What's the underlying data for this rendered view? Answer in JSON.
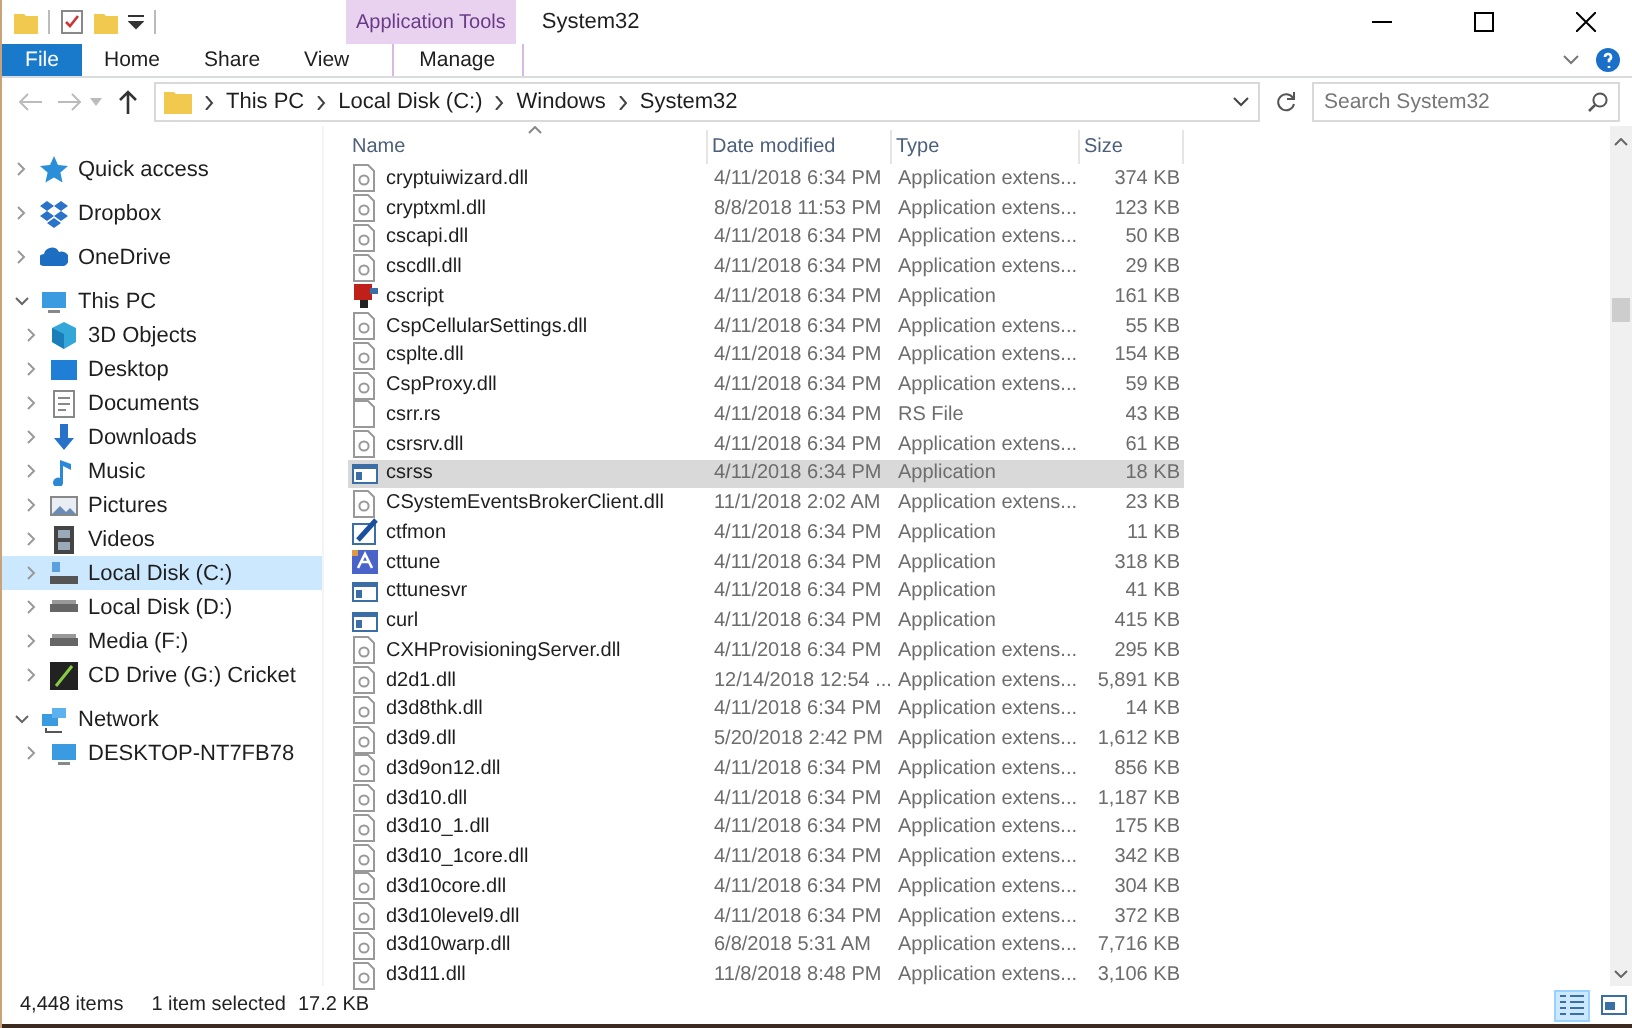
{
  "window": {
    "contextual_tab": "Application Tools",
    "title": "System32"
  },
  "ribbon_tabs": [
    {
      "label": "File",
      "kind": "file"
    },
    {
      "label": "Home",
      "kind": "normal"
    },
    {
      "label": "Share",
      "kind": "normal"
    },
    {
      "label": "View",
      "kind": "normal"
    },
    {
      "label": "Manage",
      "kind": "contextual"
    }
  ],
  "address_bar": {
    "path": [
      "This PC",
      "Local Disk (C:)",
      "Windows",
      "System32"
    ]
  },
  "search": {
    "placeholder": "Search System32"
  },
  "sidebar": {
    "items": [
      {
        "label": "Quick access",
        "kind": "star",
        "expanded": false,
        "selected": false
      },
      {
        "label": "Dropbox",
        "kind": "dropbox",
        "expanded": false,
        "selected": false
      },
      {
        "label": "OneDrive",
        "kind": "cloud",
        "expanded": false,
        "selected": false
      },
      {
        "label": "This PC",
        "kind": "pc",
        "expanded": true,
        "selected": false,
        "children": [
          {
            "label": "3D Objects",
            "kind": "cube",
            "expanded": false,
            "selected": false
          },
          {
            "label": "Desktop",
            "kind": "desktop",
            "expanded": false,
            "selected": false
          },
          {
            "label": "Documents",
            "kind": "document",
            "expanded": false,
            "selected": false
          },
          {
            "label": "Downloads",
            "kind": "download",
            "expanded": false,
            "selected": false
          },
          {
            "label": "Music",
            "kind": "music",
            "expanded": false,
            "selected": false
          },
          {
            "label": "Pictures",
            "kind": "pictures",
            "expanded": false,
            "selected": false
          },
          {
            "label": "Videos",
            "kind": "film",
            "expanded": false,
            "selected": false
          },
          {
            "label": "Local Disk (C:)",
            "kind": "system-drive",
            "expanded": false,
            "selected": true
          },
          {
            "label": "Local Disk (D:)",
            "kind": "drive",
            "expanded": false,
            "selected": false
          },
          {
            "label": "Media (F:)",
            "kind": "drive",
            "expanded": false,
            "selected": false
          },
          {
            "label": "CD Drive (G:) Cricket",
            "kind": "cd",
            "expanded": false,
            "selected": false
          }
        ]
      },
      {
        "label": "Network",
        "kind": "network",
        "expanded": true,
        "selected": false,
        "children": [
          {
            "label": "DESKTOP-NT7FB78",
            "kind": "pc",
            "expanded": false,
            "selected": false
          }
        ]
      }
    ]
  },
  "table": {
    "columns": [
      {
        "label": "Name",
        "sorted": true
      },
      {
        "label": "Date modified",
        "sorted": false
      },
      {
        "label": "Type",
        "sorted": false
      },
      {
        "label": "Size",
        "sorted": false
      }
    ],
    "rows": [
      {
        "name": "cryptuiwizard.dll",
        "date": "4/11/2018 6:34 PM",
        "type": "Application extens...",
        "size": "374 KB",
        "kind": "dll",
        "selected": false
      },
      {
        "name": "cryptxml.dll",
        "date": "8/8/2018 11:53 PM",
        "type": "Application extens...",
        "size": "123 KB",
        "kind": "dll",
        "selected": false
      },
      {
        "name": "cscapi.dll",
        "date": "4/11/2018 6:34 PM",
        "type": "Application extens...",
        "size": "50 KB",
        "kind": "dll",
        "selected": false
      },
      {
        "name": "cscdll.dll",
        "date": "4/11/2018 6:34 PM",
        "type": "Application extens...",
        "size": "29 KB",
        "kind": "dll",
        "selected": false
      },
      {
        "name": "cscript",
        "date": "4/11/2018 6:34 PM",
        "type": "Application",
        "size": "161 KB",
        "kind": "script",
        "selected": false
      },
      {
        "name": "CspCellularSettings.dll",
        "date": "4/11/2018 6:34 PM",
        "type": "Application extens...",
        "size": "55 KB",
        "kind": "dll",
        "selected": false
      },
      {
        "name": "csplte.dll",
        "date": "4/11/2018 6:34 PM",
        "type": "Application extens...",
        "size": "154 KB",
        "kind": "dll",
        "selected": false
      },
      {
        "name": "CspProxy.dll",
        "date": "4/11/2018 6:34 PM",
        "type": "Application extens...",
        "size": "59 KB",
        "kind": "dll",
        "selected": false
      },
      {
        "name": "csrr.rs",
        "date": "4/11/2018 6:34 PM",
        "type": "RS File",
        "size": "43 KB",
        "kind": "file",
        "selected": false
      },
      {
        "name": "csrsrv.dll",
        "date": "4/11/2018 6:34 PM",
        "type": "Application extens...",
        "size": "61 KB",
        "kind": "dll",
        "selected": false
      },
      {
        "name": "csrss",
        "date": "4/11/2018 6:34 PM",
        "type": "Application",
        "size": "18 KB",
        "kind": "app",
        "selected": true
      },
      {
        "name": "CSystemEventsBrokerClient.dll",
        "date": "11/1/2018 2:02 AM",
        "type": "Application extens...",
        "size": "23 KB",
        "kind": "dll",
        "selected": false
      },
      {
        "name": "ctfmon",
        "date": "4/11/2018 6:34 PM",
        "type": "Application",
        "size": "11 KB",
        "kind": "pen",
        "selected": false
      },
      {
        "name": "cttune",
        "date": "4/11/2018 6:34 PM",
        "type": "Application",
        "size": "318 KB",
        "kind": "tune",
        "selected": false
      },
      {
        "name": "cttunesvr",
        "date": "4/11/2018 6:34 PM",
        "type": "Application",
        "size": "41 KB",
        "kind": "app",
        "selected": false
      },
      {
        "name": "curl",
        "date": "4/11/2018 6:34 PM",
        "type": "Application",
        "size": "415 KB",
        "kind": "app",
        "selected": false
      },
      {
        "name": "CXHProvisioningServer.dll",
        "date": "4/11/2018 6:34 PM",
        "type": "Application extens...",
        "size": "295 KB",
        "kind": "dll",
        "selected": false
      },
      {
        "name": "d2d1.dll",
        "date": "12/14/2018 12:54 ...",
        "type": "Application extens...",
        "size": "5,891 KB",
        "kind": "dll",
        "selected": false
      },
      {
        "name": "d3d8thk.dll",
        "date": "4/11/2018 6:34 PM",
        "type": "Application extens...",
        "size": "14 KB",
        "kind": "dll",
        "selected": false
      },
      {
        "name": "d3d9.dll",
        "date": "5/20/2018 2:42 PM",
        "type": "Application extens...",
        "size": "1,612 KB",
        "kind": "dll",
        "selected": false
      },
      {
        "name": "d3d9on12.dll",
        "date": "4/11/2018 6:34 PM",
        "type": "Application extens...",
        "size": "856 KB",
        "kind": "dll",
        "selected": false
      },
      {
        "name": "d3d10.dll",
        "date": "4/11/2018 6:34 PM",
        "type": "Application extens...",
        "size": "1,187 KB",
        "kind": "dll",
        "selected": false
      },
      {
        "name": "d3d10_1.dll",
        "date": "4/11/2018 6:34 PM",
        "type": "Application extens...",
        "size": "175 KB",
        "kind": "dll",
        "selected": false
      },
      {
        "name": "d3d10_1core.dll",
        "date": "4/11/2018 6:34 PM",
        "type": "Application extens...",
        "size": "342 KB",
        "kind": "dll",
        "selected": false
      },
      {
        "name": "d3d10core.dll",
        "date": "4/11/2018 6:34 PM",
        "type": "Application extens...",
        "size": "304 KB",
        "kind": "dll",
        "selected": false
      },
      {
        "name": "d3d10level9.dll",
        "date": "4/11/2018 6:34 PM",
        "type": "Application extens...",
        "size": "372 KB",
        "kind": "dll",
        "selected": false
      },
      {
        "name": "d3d10warp.dll",
        "date": "6/8/2018 5:31 AM",
        "type": "Application extens...",
        "size": "7,716 KB",
        "kind": "dll",
        "selected": false
      },
      {
        "name": "d3d11.dll",
        "date": "11/8/2018 8:48 PM",
        "type": "Application extens...",
        "size": "3,106 KB",
        "kind": "dll",
        "selected": false
      }
    ]
  },
  "status_bar": {
    "item_count": "4,448 items",
    "selection": "1 item selected",
    "selection_size": "17.2 KB"
  },
  "view_buttons": [
    {
      "kind": "details",
      "selected": true
    },
    {
      "kind": "large-icons",
      "selected": false
    }
  ]
}
